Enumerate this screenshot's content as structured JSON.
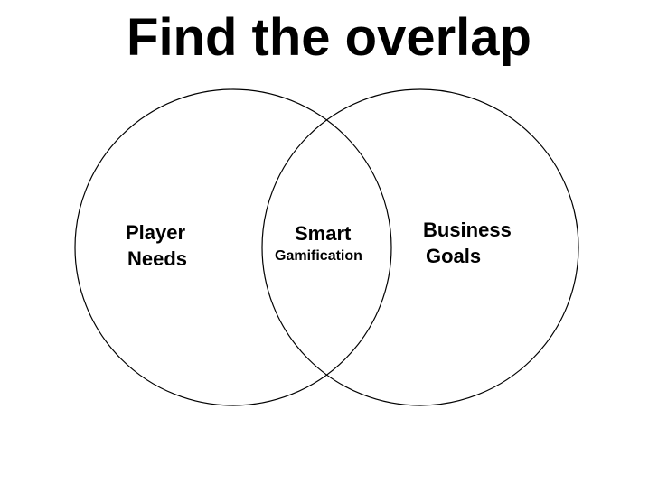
{
  "title": "Find the overlap",
  "colors": {
    "stroke": "#000000",
    "text": "#000000",
    "background": "#ffffff"
  },
  "sets": [
    {
      "id": "player",
      "lines": [
        "Player",
        "Needs"
      ]
    },
    {
      "id": "business",
      "lines": [
        "Business",
        "Goals"
      ]
    }
  ],
  "overlap": {
    "lines": [
      "Smart",
      "Gamification"
    ]
  }
}
